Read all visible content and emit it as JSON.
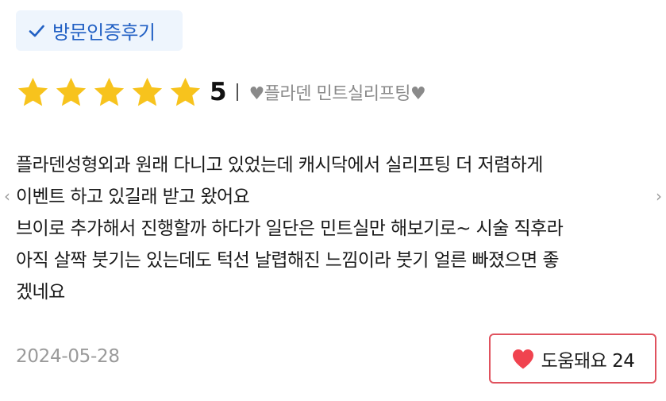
{
  "badge": {
    "label": "방문인증후기",
    "icon": "check-icon",
    "color": "#2160c4"
  },
  "rating": {
    "stars_filled": 5,
    "stars_total": 5,
    "score": "5",
    "star_color": "#f7c31d",
    "product": "♥플라덴 민트실리프팅♥"
  },
  "review": {
    "lines": [
      "플라덴성형외과 원래 다니고 있었는데 캐시닥에서 실리프팅 더 저렴하게",
      "이벤트 하고 있길래 받고 왔어요",
      "브이로 추가해서 진행할까 하다가 일단은 민트실만 해보기로~ 시술 직후라",
      "아직 살짝 붓기는 있는데도 턱선 날렵해진 느낌이라 붓기 얼른 빠졌으면 좋",
      "겠네요"
    ]
  },
  "nav": {
    "prev": "‹",
    "next": "›"
  },
  "footer": {
    "date": "2024-05-28",
    "helpful_label": "도움돼요 24",
    "heart_color": "#f0434f"
  }
}
